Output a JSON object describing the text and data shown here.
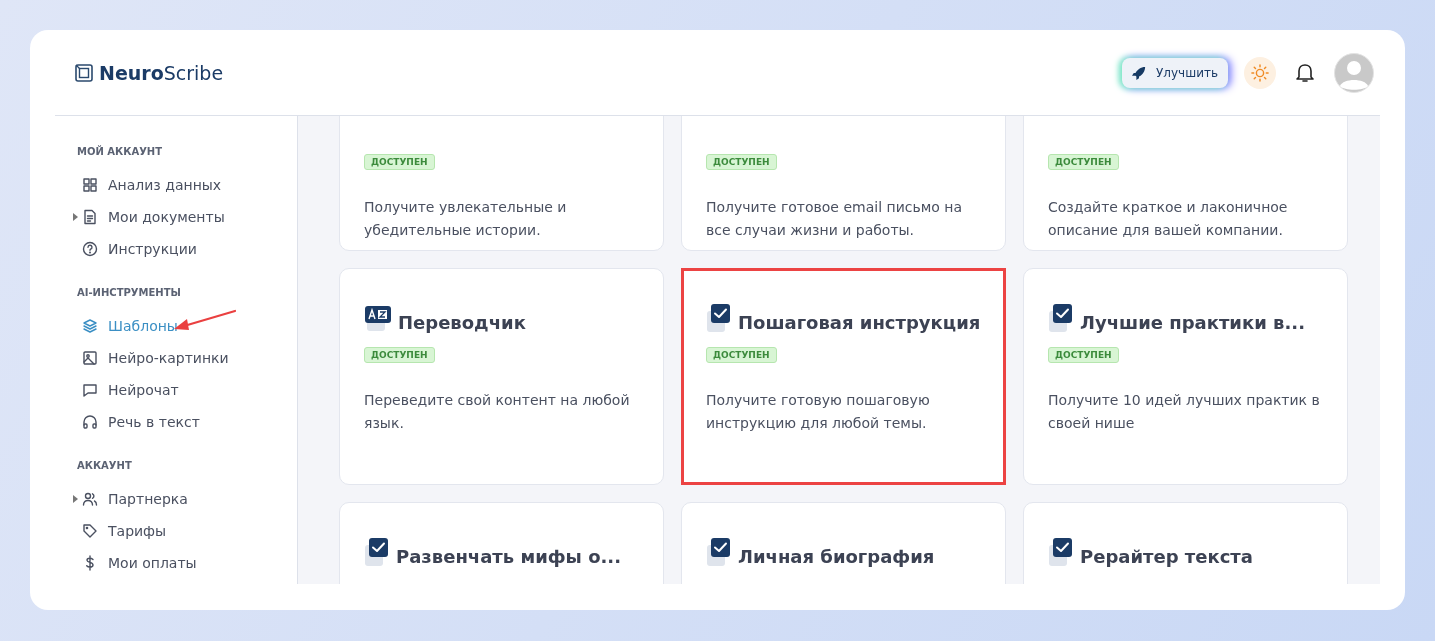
{
  "logo": {
    "bold": "Neuro",
    "rest": "Scribe"
  },
  "header": {
    "upgrade_button": "Улучшить"
  },
  "sidebar": {
    "sections": [
      {
        "title": "МОЙ АККАУНТ",
        "items": [
          {
            "label": "Анализ данных",
            "expandable": false,
            "selected": false
          },
          {
            "label": "Мои документы",
            "expandable": true,
            "selected": false
          },
          {
            "label": "Инструкции",
            "expandable": false,
            "selected": false
          }
        ]
      },
      {
        "title": "AI-ИНСТРУМЕНТЫ",
        "items": [
          {
            "label": "Шаблоны",
            "expandable": false,
            "selected": true,
            "annotated": true
          },
          {
            "label": "Нейро-картинки",
            "expandable": false,
            "selected": false
          },
          {
            "label": "Нейрочат",
            "expandable": false,
            "selected": false
          },
          {
            "label": "Речь в текст",
            "expandable": false,
            "selected": false
          }
        ]
      },
      {
        "title": "АККАУНТ",
        "items": [
          {
            "label": "Партнерка",
            "expandable": true,
            "selected": false
          },
          {
            "label": "Тарифы",
            "expandable": false,
            "selected": false
          },
          {
            "label": "Мои оплаты",
            "expandable": false,
            "selected": false
          }
        ]
      }
    ]
  },
  "cards": [
    {
      "badge": "ДОСТУПЕН",
      "description": "Получите увлекательные и убедительные истории.",
      "highlighted": false
    },
    {
      "badge": "ДОСТУПЕН",
      "description": "Получите готовое email письмо на все случаи жизни и работы.",
      "highlighted": false
    },
    {
      "badge": "ДОСТУПЕН",
      "description": "Создайте краткое и лаконичное описание для вашей компании.",
      "highlighted": false
    },
    {
      "title": "Переводчик",
      "badge": "ДОСТУПЕН",
      "description": "Переведите свой контент на любой язык.",
      "highlighted": false
    },
    {
      "title": "Пошаговая инструкция",
      "badge": "ДОСТУПЕН",
      "description": "Получите готовую пошаговую инструкцию для любой темы.",
      "highlighted": true
    },
    {
      "title": "Лучшие практики в...",
      "badge": "ДОСТУПЕН",
      "description": "Получите 10 идей лучших практик в своей нише",
      "highlighted": false
    },
    {
      "title": "Развенчать мифы о...",
      "highlighted": false
    },
    {
      "title": "Личная биография",
      "highlighted": false
    },
    {
      "title": "Рерайтер текста",
      "highlighted": false
    }
  ]
}
